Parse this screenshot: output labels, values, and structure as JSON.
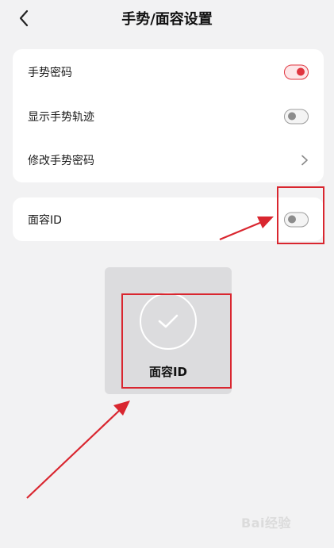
{
  "header": {
    "title": "手势/面容设置",
    "back_icon": "chevron-left-icon"
  },
  "settings": {
    "gesture_password": {
      "label": "手势密码",
      "enabled": true
    },
    "show_gesture_trace": {
      "label": "显示手势轨迹",
      "enabled": false
    },
    "change_gesture_password": {
      "label": "修改手势密码"
    },
    "face_id": {
      "label": "面容ID",
      "enabled": false
    }
  },
  "face_overlay": {
    "label": "面容ID"
  },
  "watermark": {
    "text": "Bai经验"
  },
  "colors": {
    "accent_red": "#e0353f",
    "annotation_red": "#d9262f",
    "background": "#f2f2f3",
    "card": "#ffffff"
  }
}
